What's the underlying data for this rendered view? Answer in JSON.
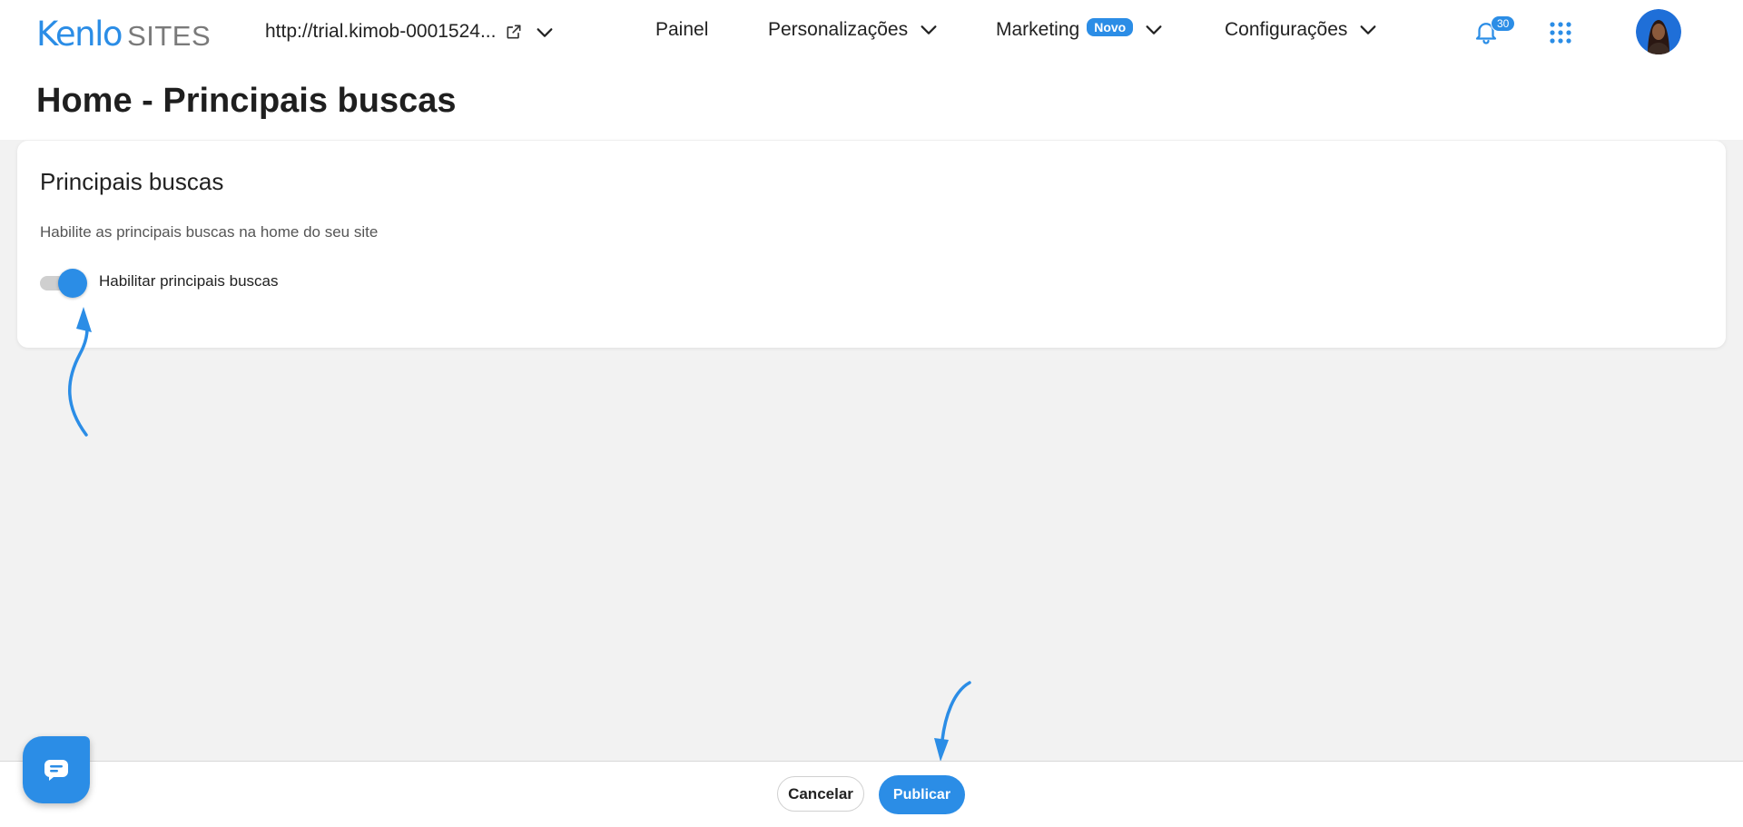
{
  "header": {
    "logo_brand": "Kenlo",
    "logo_product": "SITES",
    "site_url": "http://trial.kimob-0001524...",
    "nav": {
      "painel": "Painel",
      "personalizacoes": "Personalizações",
      "marketing": "Marketing",
      "marketing_badge": "Novo",
      "configuracoes": "Configurações"
    },
    "notifications_count": "30",
    "icons": [
      "external-link-icon",
      "chevron-down-icon",
      "bell-icon",
      "apps-grid-icon"
    ]
  },
  "page": {
    "title": "Home - Principais buscas"
  },
  "card": {
    "title": "Principais buscas",
    "description": "Habilite as principais buscas na home do seu site",
    "toggle_label": "Habilitar principais buscas",
    "toggle_on": true
  },
  "footer": {
    "cancel_label": "Cancelar",
    "publish_label": "Publicar"
  },
  "colors": {
    "accent": "#2b8de6",
    "background": "#f2f2f2",
    "surface": "#ffffff"
  }
}
